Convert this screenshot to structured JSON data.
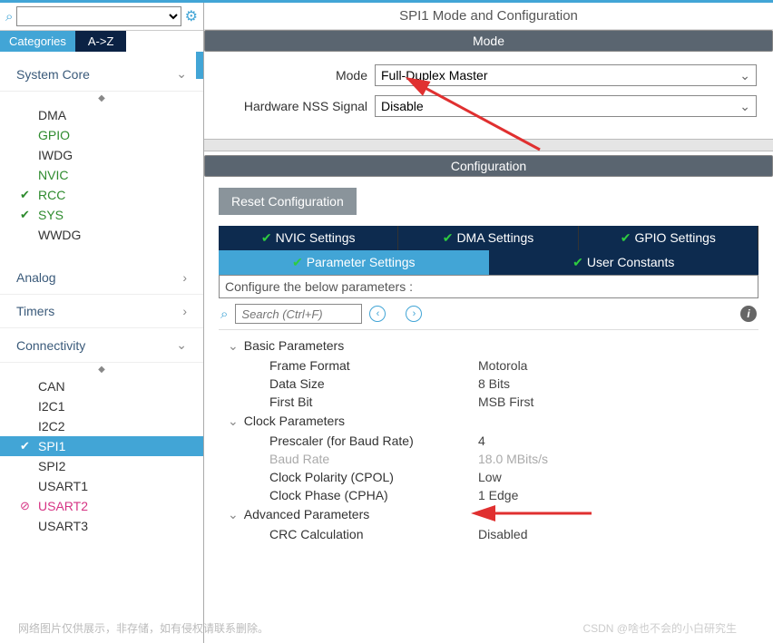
{
  "header": {
    "title": "SPI1 Mode and Configuration"
  },
  "tabs": {
    "categories": "Categories",
    "az": "A->Z"
  },
  "sidebar": {
    "system_core": {
      "label": "System Core",
      "items": [
        {
          "label": "DMA"
        },
        {
          "label": "GPIO"
        },
        {
          "label": "IWDG"
        },
        {
          "label": "NVIC"
        },
        {
          "label": "RCC"
        },
        {
          "label": "SYS"
        },
        {
          "label": "WWDG"
        }
      ]
    },
    "analog": {
      "label": "Analog"
    },
    "timers": {
      "label": "Timers"
    },
    "connectivity": {
      "label": "Connectivity",
      "items": [
        {
          "label": "CAN"
        },
        {
          "label": "I2C1"
        },
        {
          "label": "I2C2"
        },
        {
          "label": "SPI1"
        },
        {
          "label": "SPI2"
        },
        {
          "label": "USART1"
        },
        {
          "label": "USART2"
        },
        {
          "label": "USART3"
        }
      ]
    }
  },
  "mode": {
    "bar": "Mode",
    "mode_label": "Mode",
    "mode_value": "Full-Duplex Master",
    "nss_label": "Hardware NSS Signal",
    "nss_value": "Disable"
  },
  "config": {
    "bar": "Configuration",
    "reset": "Reset Configuration",
    "tabs": {
      "nvic": "NVIC Settings",
      "dma": "DMA Settings",
      "gpio": "GPIO Settings",
      "param": "Parameter Settings",
      "user": "User Constants"
    },
    "hint": "Configure the below parameters :",
    "search_placeholder": "Search (Ctrl+F)",
    "groups": {
      "basic": {
        "label": "Basic Parameters",
        "rows": [
          {
            "name": "Frame Format",
            "value": "Motorola"
          },
          {
            "name": "Data Size",
            "value": "8 Bits"
          },
          {
            "name": "First Bit",
            "value": "MSB First"
          }
        ]
      },
      "clock": {
        "label": "Clock Parameters",
        "rows": [
          {
            "name": "Prescaler (for Baud Rate)",
            "value": "4"
          },
          {
            "name": "Baud Rate",
            "value": "18.0 MBits/s"
          },
          {
            "name": "Clock Polarity (CPOL)",
            "value": "Low"
          },
          {
            "name": "Clock Phase (CPHA)",
            "value": "1 Edge"
          }
        ]
      },
      "advanced": {
        "label": "Advanced Parameters",
        "rows": [
          {
            "name": "CRC Calculation",
            "value": "Disabled"
          }
        ]
      }
    }
  },
  "watermark": {
    "left": "网络图片仅供展示，非存储，如有侵权请联系删除。",
    "right": "CSDN @啥也不会的小白研究生"
  }
}
